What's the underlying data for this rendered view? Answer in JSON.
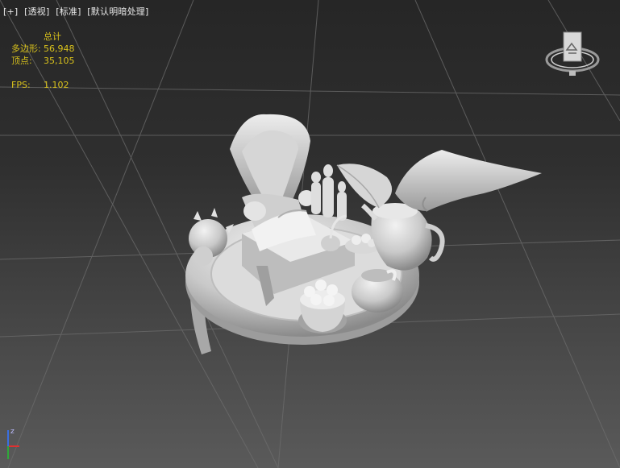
{
  "viewport": {
    "labels": [
      "[+]",
      "[透视]",
      "[标准]",
      "[默认明暗处理]"
    ]
  },
  "stats": {
    "title": "总计",
    "polygons_label": "多边形:",
    "polygons_value": "56,948",
    "vertices_label": "顶点:",
    "vertices_value": "35,105",
    "fps_label": "FPS:",
    "fps_value": "1.102"
  },
  "axis": {
    "z_label": "z"
  },
  "colors": {
    "stats_text": "#d9c21c",
    "label_text": "#e8e8e8",
    "model_light": "#e6e6e6",
    "model_shadow": "#8c8c8c",
    "grid_line": "#6a6a6a"
  }
}
